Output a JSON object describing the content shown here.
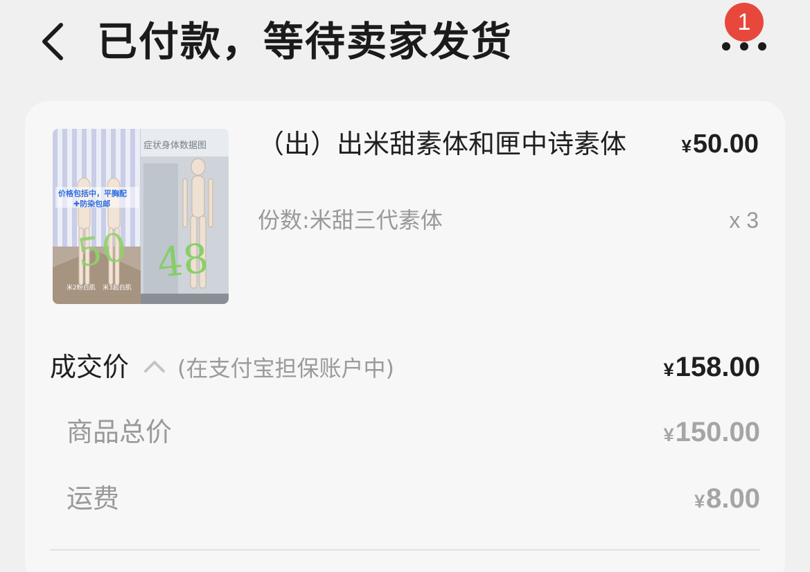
{
  "header": {
    "title": "已付款，等待卖家发货",
    "back_icon": "chevron-left-icon",
    "more_icon": "more-dots-icon",
    "notification_count": "1",
    "badge_color": "#e8483b"
  },
  "order": {
    "item": {
      "title": "（出）出米甜素体和匣中诗素体",
      "currency": "¥",
      "price": "50.00",
      "variant": "份数:米甜三代素体",
      "quantity": "x 3",
      "thumbnail": {
        "overlay_text": "价格包括中，平胸配\n✚防染包邮",
        "banner_text": "症状身体数据图",
        "handwritten_left": "50",
        "handwritten_right": "48",
        "caption_left": "米2粉白肌",
        "caption_right": "米3超白肌"
      }
    },
    "deal": {
      "label": "成交价",
      "note": "(在支付宝担保账户中)",
      "currency": "¥",
      "amount": "158.00",
      "toggle_icon": "chevron-up-icon"
    },
    "breakdown": [
      {
        "label": "商品总价",
        "currency": "¥",
        "amount": "150.00"
      },
      {
        "label": "运费",
        "currency": "¥",
        "amount": "8.00"
      }
    ]
  }
}
